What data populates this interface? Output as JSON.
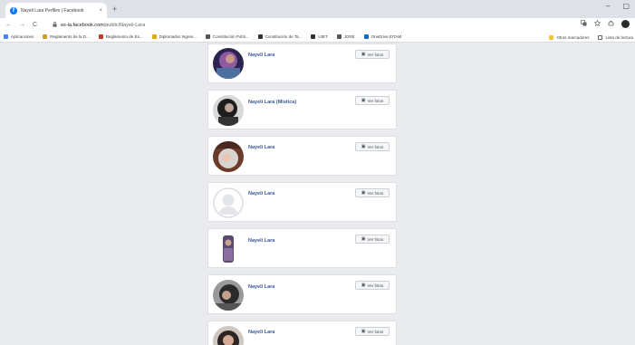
{
  "browser": {
    "tab_title": "Nayeli Lara Perfiles | Facebook",
    "tab_favicon": "f",
    "tab_close": "×",
    "new_tab": "+",
    "minimize": "–",
    "maximize": "▢",
    "back": "←",
    "forward": "→",
    "reload": "C",
    "url_domain": "es-la.facebook.com",
    "url_path": "/public/Nayeli-Lara"
  },
  "bookmarks": {
    "items": [
      {
        "label": "Aplicaciones",
        "color": "#4285f4"
      },
      {
        "label": "Reglamento de la D...",
        "color": "#c9a227"
      },
      {
        "label": "Reglamento de Es...",
        "color": "#c0392b"
      },
      {
        "label": "Diplomados Ingres...",
        "color": "#e0a800"
      },
      {
        "label": "Constitución Políti...",
        "color": "#555555"
      },
      {
        "label": "Constitución de Ta...",
        "color": "#333333"
      },
      {
        "label": "UIET",
        "color": "#333333"
      },
      {
        "label": "JORE",
        "color": "#555555"
      },
      {
        "label": "OneDrive EITAM",
        "color": "#0f6cbd"
      }
    ],
    "other": "Otros marcadores",
    "reading_list": "Lista de lectura"
  },
  "results": [
    {
      "name": "Nayeli Lara",
      "button": "Ver fotos",
      "avatar": "purple-photo"
    },
    {
      "name": "Nayeli Lara (Mistica)",
      "button": "Ver fotos",
      "avatar": "dark-photo"
    },
    {
      "name": "Nayeli Lara",
      "button": "Ver fotos",
      "avatar": "baby-photo"
    },
    {
      "name": "Nayeli Lara",
      "button": "Ver fotos",
      "avatar": "default-silhouette"
    },
    {
      "name": "Nayeli Lara",
      "button": "Ver fotos",
      "avatar": "tall-photo"
    },
    {
      "name": "Nayeli Lara",
      "button": "Ver fotos",
      "avatar": "selfie-photo"
    },
    {
      "name": "Nayeli Lara",
      "button": "Ver fotos",
      "avatar": "portrait-photo"
    }
  ],
  "colors": {
    "link": "#385898",
    "page_bg": "#e9ebee",
    "facebook_blue": "#1877f2"
  }
}
